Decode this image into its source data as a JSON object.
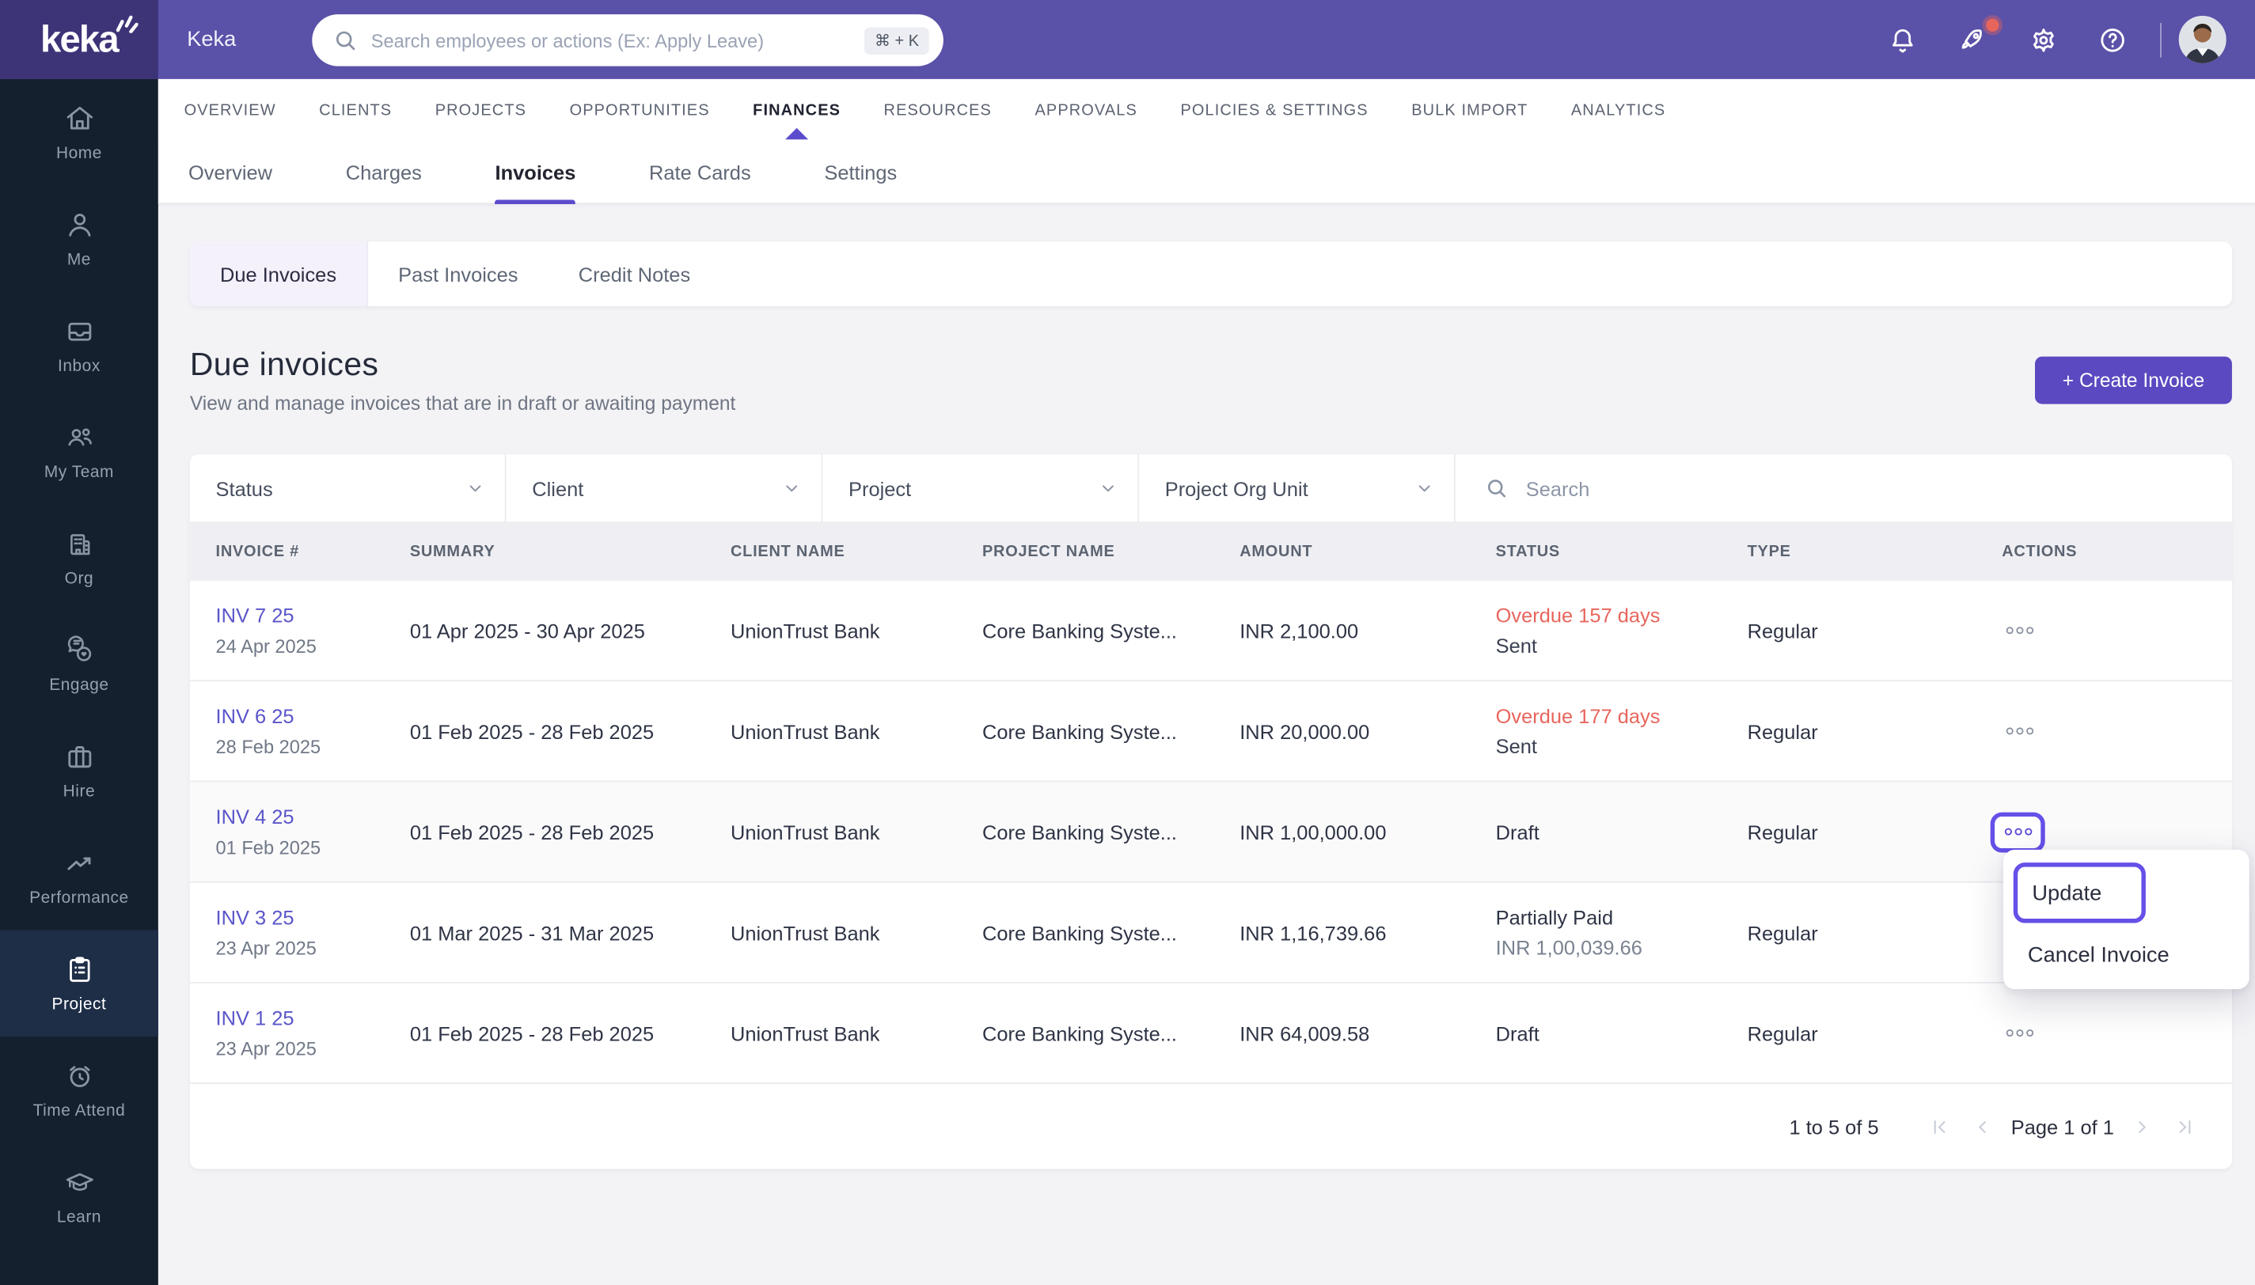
{
  "topbar": {
    "logo_text": "keka",
    "brand": "Keka",
    "search_placeholder": "Search employees or actions (Ex: Apply Leave)",
    "shortcut": "⌘ + K"
  },
  "sidebar": {
    "active_index": 8,
    "items": [
      {
        "label": "Home",
        "icon": "home-icon"
      },
      {
        "label": "Me",
        "icon": "user-icon"
      },
      {
        "label": "Inbox",
        "icon": "inbox-icon"
      },
      {
        "label": "My Team",
        "icon": "team-icon"
      },
      {
        "label": "Org",
        "icon": "building-icon"
      },
      {
        "label": "Engage",
        "icon": "engage-icon"
      },
      {
        "label": "Hire",
        "icon": "briefcase-icon"
      },
      {
        "label": "Performance",
        "icon": "trend-icon"
      },
      {
        "label": "Project",
        "icon": "clipboard-icon"
      },
      {
        "label": "Time Attend",
        "icon": "alarm-icon"
      },
      {
        "label": "Learn",
        "icon": "grad-cap-icon"
      }
    ]
  },
  "nav": {
    "active_index": 4,
    "tabs": [
      "OVERVIEW",
      "CLIENTS",
      "PROJECTS",
      "OPPORTUNITIES",
      "FINANCES",
      "RESOURCES",
      "APPROVALS",
      "POLICIES & SETTINGS",
      "BULK IMPORT",
      "ANALYTICS"
    ]
  },
  "subnav": {
    "active_index": 2,
    "tabs": [
      "Overview",
      "Charges",
      "Invoices",
      "Rate Cards",
      "Settings"
    ]
  },
  "view_tabs": {
    "active_index": 0,
    "tabs": [
      "Due Invoices",
      "Past Invoices",
      "Credit Notes"
    ]
  },
  "page": {
    "title": "Due invoices",
    "subtitle": "View and manage invoices that are in draft or awaiting payment",
    "create_button": "+ Create Invoice"
  },
  "filters": {
    "dropdowns": [
      "Status",
      "Client",
      "Project",
      "Project Org Unit"
    ],
    "search_placeholder": "Search"
  },
  "table": {
    "columns": [
      "INVOICE #",
      "SUMMARY",
      "CLIENT NAME",
      "PROJECT NAME",
      "AMOUNT",
      "STATUS",
      "TYPE",
      "ACTIONS"
    ],
    "rows": [
      {
        "invoice": "INV 7 25",
        "date": "24 Apr 2025",
        "summary": "01 Apr 2025 - 30 Apr 2025",
        "client": "UnionTrust Bank",
        "project": "Core Banking Syste...",
        "amount": "INR 2,100.00",
        "status": "Overdue 157 days",
        "status_color": "red",
        "sub": "Sent",
        "sub_color": "dark",
        "type": "Regular",
        "selected": false
      },
      {
        "invoice": "INV 6 25",
        "date": "28 Feb 2025",
        "summary": "01 Feb 2025 - 28 Feb 2025",
        "client": "UnionTrust Bank",
        "project": "Core Banking Syste...",
        "amount": "INR 20,000.00",
        "status": "Overdue 177 days",
        "status_color": "red",
        "sub": "Sent",
        "sub_color": "dark",
        "type": "Regular",
        "selected": false
      },
      {
        "invoice": "INV 4 25",
        "date": "01 Feb 2025",
        "summary": "01 Feb 2025 - 28 Feb 2025",
        "client": "UnionTrust Bank",
        "project": "Core Banking Syste...",
        "amount": "INR 1,00,000.00",
        "status": "Draft",
        "status_color": "dark",
        "sub": "",
        "sub_color": "dark",
        "type": "Regular",
        "selected": true
      },
      {
        "invoice": "INV 3 25",
        "date": "23 Apr 2025",
        "summary": "01 Mar 2025 - 31 Mar 2025",
        "client": "UnionTrust Bank",
        "project": "Core Banking Syste...",
        "amount": "INR 1,16,739.66",
        "status": "Partially Paid",
        "status_color": "dark",
        "sub": "INR 1,00,039.66",
        "sub_color": "gray",
        "type": "Regular",
        "selected": false
      },
      {
        "invoice": "INV 1 25",
        "date": "23 Apr 2025",
        "summary": "01 Feb 2025 - 28 Feb 2025",
        "client": "UnionTrust Bank",
        "project": "Core Banking Syste...",
        "amount": "INR 64,009.58",
        "status": "Draft",
        "status_color": "dark",
        "sub": "",
        "sub_color": "dark",
        "type": "Regular",
        "selected": false
      }
    ]
  },
  "context_menu": {
    "items": [
      "Update",
      "Cancel Invoice"
    ],
    "highlighted": "Update"
  },
  "pagination": {
    "range": "1 to 5 of 5",
    "page": "Page 1 of 1"
  },
  "colors": {
    "topbar": "#5a51a8",
    "logo_box": "#3d3478",
    "sidebar": "#15202e",
    "accent": "#5b4ccc",
    "button": "#5a49c0",
    "overdue_red": "#e8655c",
    "link": "#5a55c9"
  }
}
